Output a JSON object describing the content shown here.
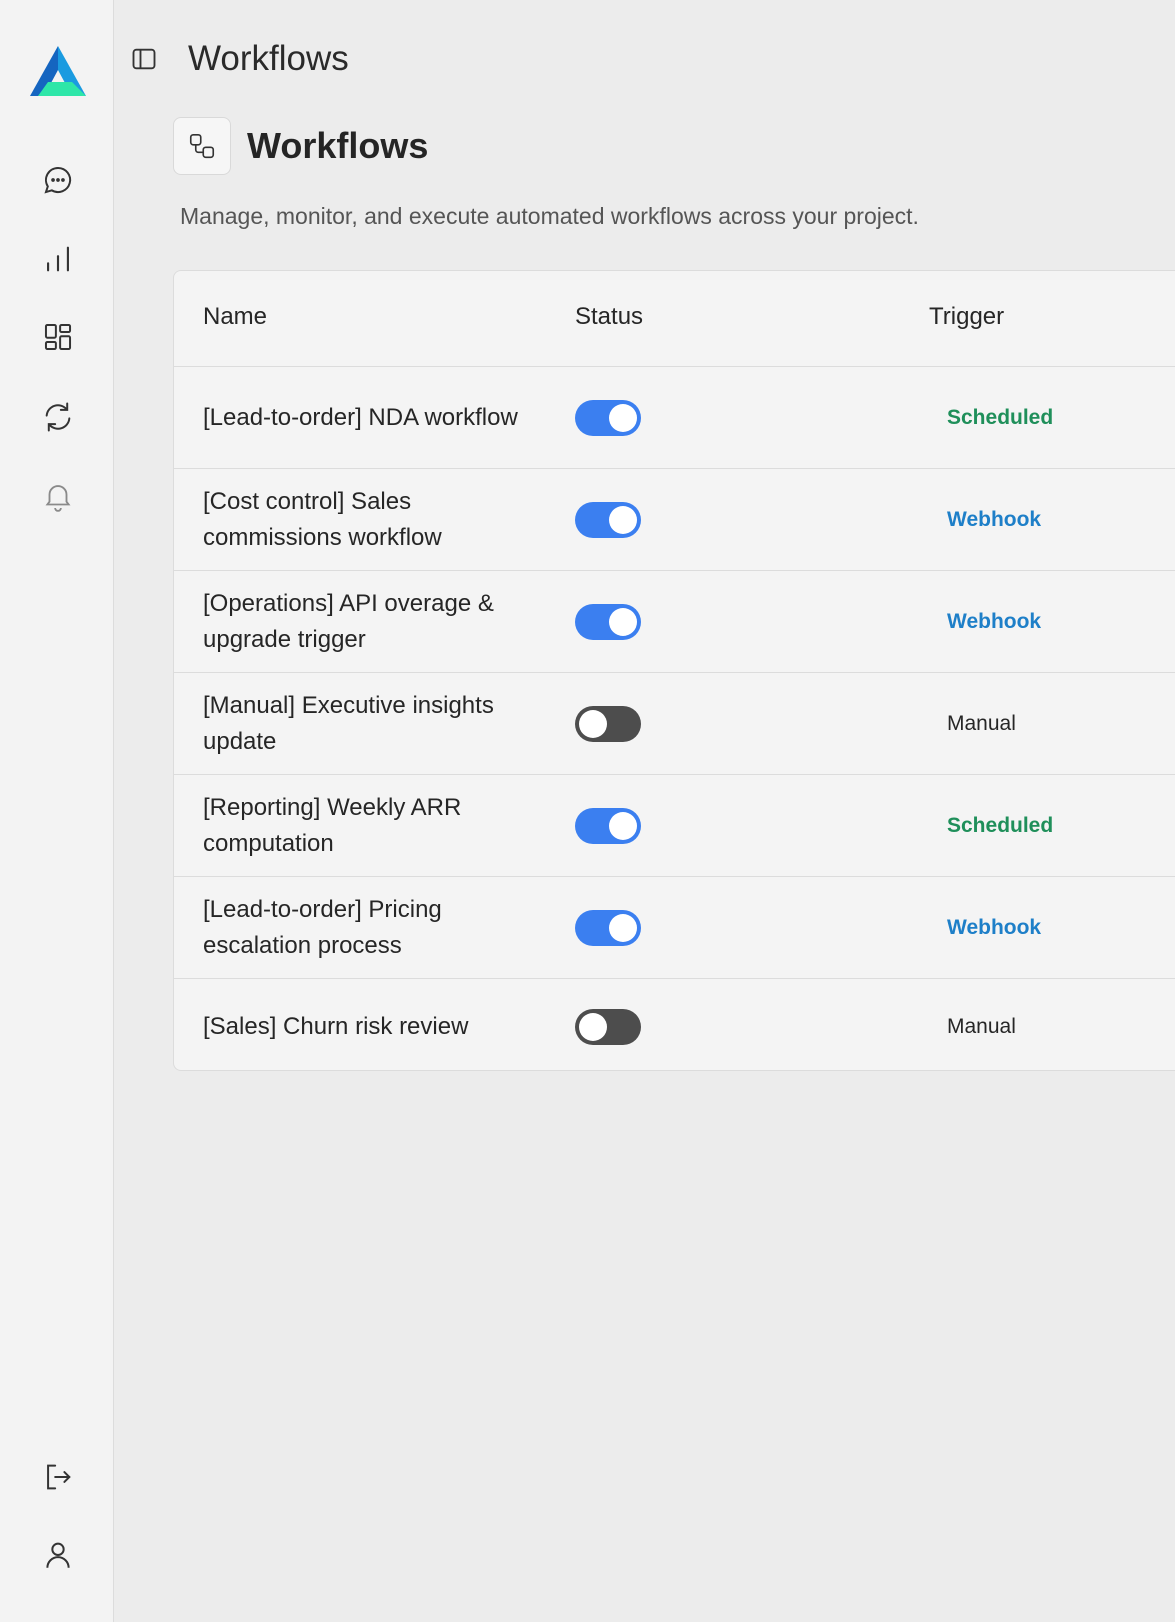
{
  "topbar": {
    "title": "Workflows"
  },
  "page": {
    "title": "Workflows",
    "subtitle": "Manage, monitor, and execute automated workflows across your project."
  },
  "table": {
    "headers": {
      "name": "Name",
      "status": "Status",
      "trigger": "Trigger"
    },
    "rows": [
      {
        "name": "[Lead-to-order] NDA workflow",
        "enabled": true,
        "trigger": "Scheduled"
      },
      {
        "name": "[Cost control] Sales commissions workflow",
        "enabled": true,
        "trigger": "Webhook"
      },
      {
        "name": "[Operations] API overage & upgrade trigger",
        "enabled": true,
        "trigger": "Webhook"
      },
      {
        "name": "[Manual] Executive insights update",
        "enabled": false,
        "trigger": "Manual"
      },
      {
        "name": "[Reporting] Weekly ARR computation",
        "enabled": true,
        "trigger": "Scheduled"
      },
      {
        "name": "[Lead-to-order] Pricing escalation process",
        "enabled": true,
        "trigger": "Webhook"
      },
      {
        "name": "[Sales] Churn risk review",
        "enabled": false,
        "trigger": "Manual"
      }
    ]
  },
  "colors": {
    "toggle_on": "#3b7ff0",
    "toggle_off": "#4d4d4d",
    "scheduled": "#1f8f5a",
    "webhook": "#1e7fc8"
  },
  "icons": {
    "sidebar": [
      "chat-icon",
      "bar-chart-icon",
      "dashboard-icon",
      "sync-icon",
      "bell-icon",
      "logout-icon",
      "user-icon"
    ]
  }
}
